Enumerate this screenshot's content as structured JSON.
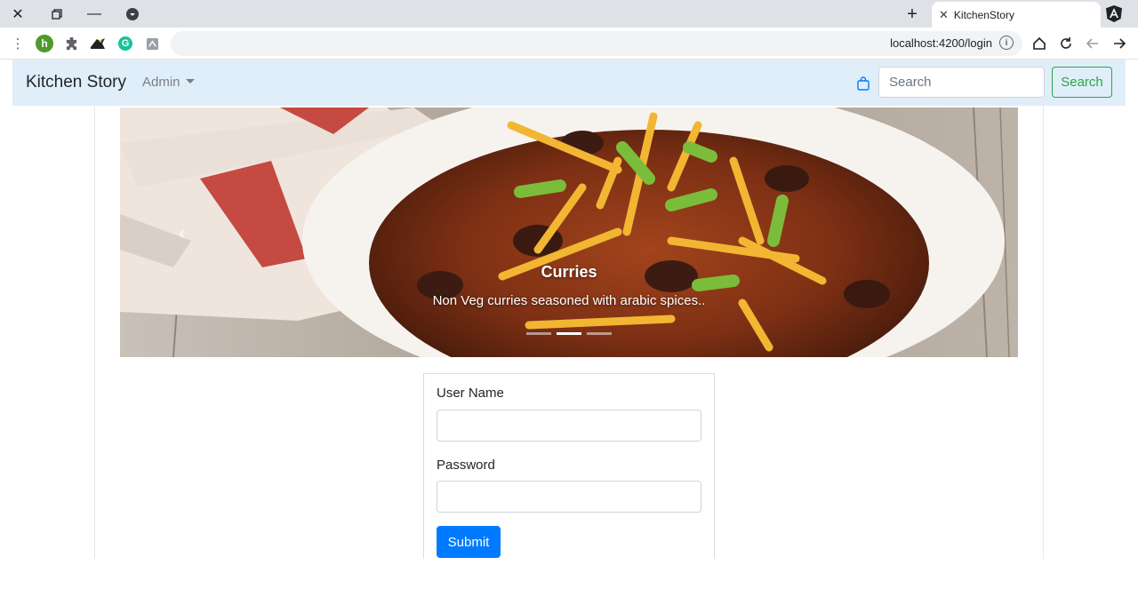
{
  "browser": {
    "tab_title": "KitchenStory",
    "url": "localhost:4200/login",
    "extension_h_label": "h",
    "extension_g_label": "G"
  },
  "navbar": {
    "brand": "Kitchen Story",
    "admin_menu": "Admin",
    "search_placeholder": "Search",
    "search_button": "Search",
    "accent_color": "#28a745",
    "background_color": "#e0eefa"
  },
  "carousel": {
    "slide_title": "Curries",
    "slide_text": "Non Veg curries seasoned with arabic spices..",
    "indicator_count": 3,
    "active_indicator": 2
  },
  "login_form": {
    "username_label": "User Name",
    "username_value": "",
    "password_label": "Password",
    "password_value": "",
    "submit_label": "Submit",
    "submit_color": "#007bff"
  }
}
